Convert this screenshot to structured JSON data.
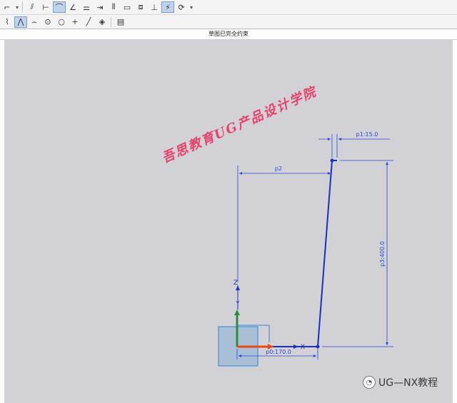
{
  "toolbar": {
    "row1": [
      "sketch-icon",
      "dropdown-icon",
      "trim-icon",
      "dimension-icon",
      "fillet-icon",
      "angle-icon",
      "pattern-icon",
      "extend-icon",
      "mirror-icon",
      "rectangle-icon",
      "offset-icon",
      "constraint-icon",
      "show-constraints-icon",
      "dropdown-icon"
    ],
    "row2": [
      "profile-icon",
      "polyline-icon",
      "arc-icon",
      "circle-icon",
      "ellipse-icon",
      "point-icon",
      "line-icon",
      "sketch-settings-icon",
      "more-icon"
    ]
  },
  "status": {
    "text": "草图已完全约束"
  },
  "dimensions": {
    "p0": "p0:170.0",
    "p1": "p1:15.0",
    "p3": "p3:400.0",
    "p2": "p2"
  },
  "axes": {
    "x": "X",
    "y": "Y",
    "z": "Z"
  },
  "watermark": {
    "text": "吾思教育UG产品设计学院"
  },
  "wechat": {
    "label": "UG—NX教程",
    "icon": "wechat-icon"
  },
  "colors": {
    "geometry": "#1c2fbd",
    "dimension": "#2a46d8",
    "x_axis": "#e64a19",
    "y_axis": "#2e8b3a",
    "viewport_bg": "#d2d2d6"
  }
}
